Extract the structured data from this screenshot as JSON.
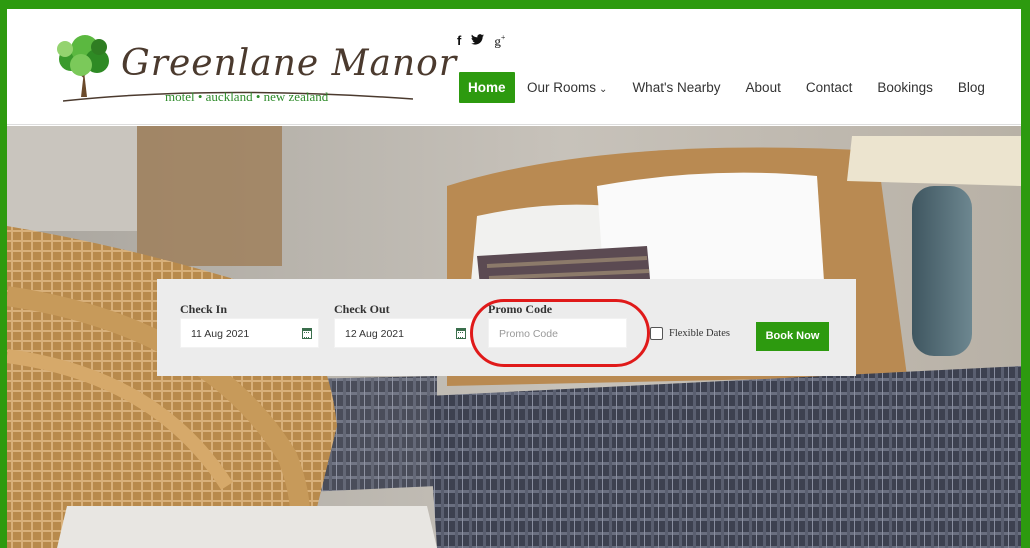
{
  "brand": {
    "name": "Greenlane Manor",
    "tagline": "motel • auckland • new zealand"
  },
  "social": {
    "facebook": "f",
    "twitter": "🐦",
    "googleplus": "g+"
  },
  "nav": {
    "items": [
      {
        "label": "Home",
        "active": true
      },
      {
        "label": "Our Rooms",
        "dropdown": true
      },
      {
        "label": "What's Nearby"
      },
      {
        "label": "About"
      },
      {
        "label": "Contact"
      },
      {
        "label": "Bookings"
      },
      {
        "label": "Blog"
      }
    ]
  },
  "booking": {
    "check_in_label": "Check In",
    "check_in_value": "11 Aug 2021",
    "check_out_label": "Check Out",
    "check_out_value": "12 Aug 2021",
    "promo_label": "Promo Code",
    "promo_placeholder": "Promo Code",
    "flexible_label": "Flexible Dates",
    "book_label": "Book Now"
  },
  "colors": {
    "accent": "#2d9a0f",
    "highlight_ring": "#e01a1a"
  }
}
